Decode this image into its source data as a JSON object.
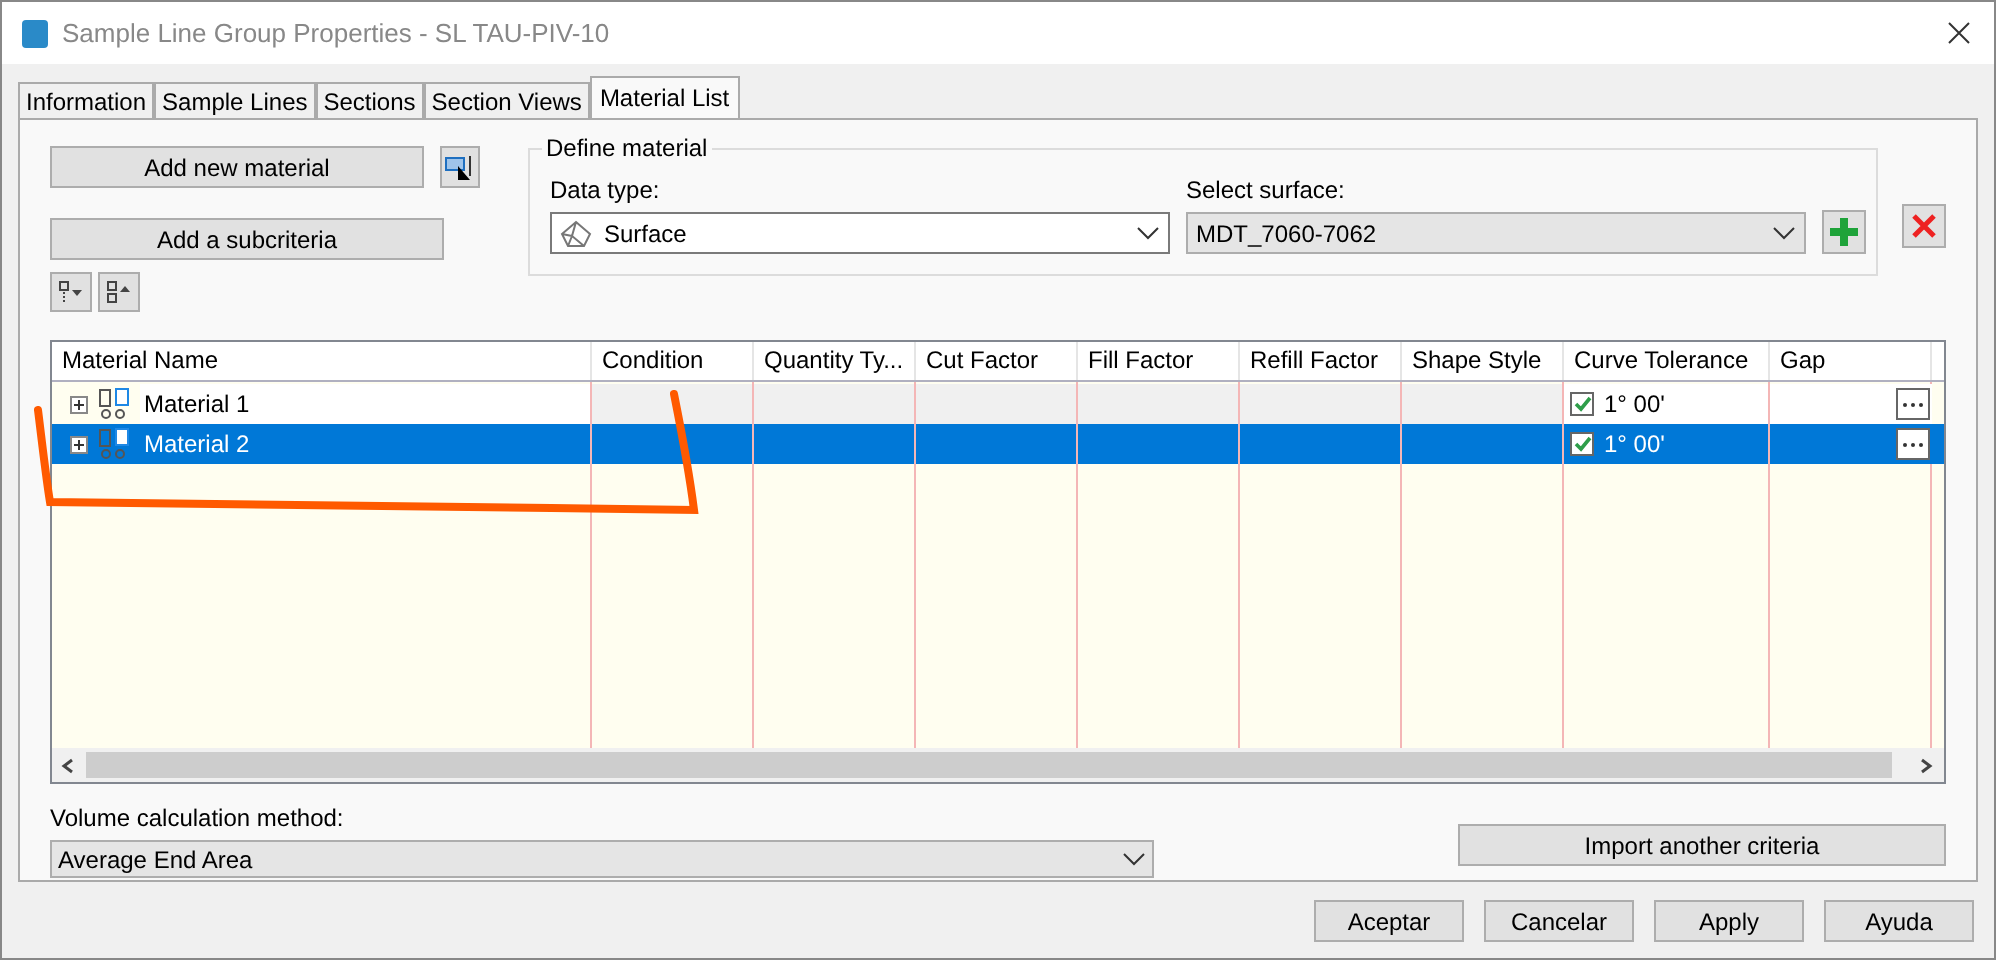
{
  "window": {
    "title": "Sample Line Group Properties - SL TAU-PIV-10"
  },
  "tabs": [
    {
      "label": "Information",
      "selected": false
    },
    {
      "label": "Sample Lines",
      "selected": false
    },
    {
      "label": "Sections",
      "selected": false
    },
    {
      "label": "Section Views",
      "selected": false
    },
    {
      "label": "Material List",
      "selected": true
    }
  ],
  "buttons": {
    "add_material": "Add new material",
    "add_subcriteria": "Add a subcriteria"
  },
  "define_material": {
    "title": "Define material",
    "data_type_label": "Data type:",
    "data_type": "Surface",
    "surface_label": "Select surface:",
    "surface": "MDT_7060-7062"
  },
  "table": {
    "columns": [
      "Material Name",
      "Condition",
      "Quantity Ty...",
      "Cut Factor",
      "Fill Factor",
      "Refill Factor",
      "Shape Style",
      "Curve Tolerance",
      "Gap"
    ],
    "rows": [
      {
        "name": "Material 1",
        "selected": false,
        "expanded": false,
        "tolerance_checked": true,
        "tolerance": "1° 00'"
      },
      {
        "name": "Material 2",
        "selected": true,
        "expanded": false,
        "tolerance_checked": true,
        "tolerance": "1° 00'"
      }
    ]
  },
  "volume": {
    "label": "Volume calculation method:",
    "value": "Average End Area"
  },
  "import_button": "Import another criteria",
  "footer_buttons": [
    "Aceptar",
    "Cancelar",
    "Apply",
    "Ayuda"
  ]
}
